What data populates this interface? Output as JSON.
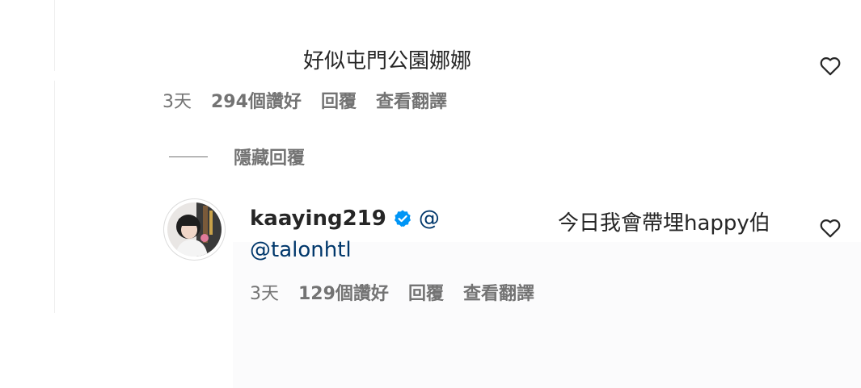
{
  "comment": {
    "text": "好似屯門公園娜娜",
    "time": "3天",
    "likes": "294個讚好",
    "reply_label": "回覆",
    "translate_label": "查看翻譯"
  },
  "hide_replies_label": "隱藏回覆",
  "reply": {
    "username": "kaaying219",
    "mention_prefix": "@",
    "text": "今日我會帶埋happy伯",
    "mention2": "@talonhtl",
    "time": "3天",
    "likes": "129個讚好",
    "reply_label": "回覆",
    "translate_label": "查看翻譯"
  },
  "icons": {
    "like": "heart-outline-icon",
    "verified": "verified-badge-icon"
  },
  "colors": {
    "text_primary": "#262626",
    "text_secondary": "#737373",
    "link": "#00376b",
    "verified": "#0095f6"
  }
}
